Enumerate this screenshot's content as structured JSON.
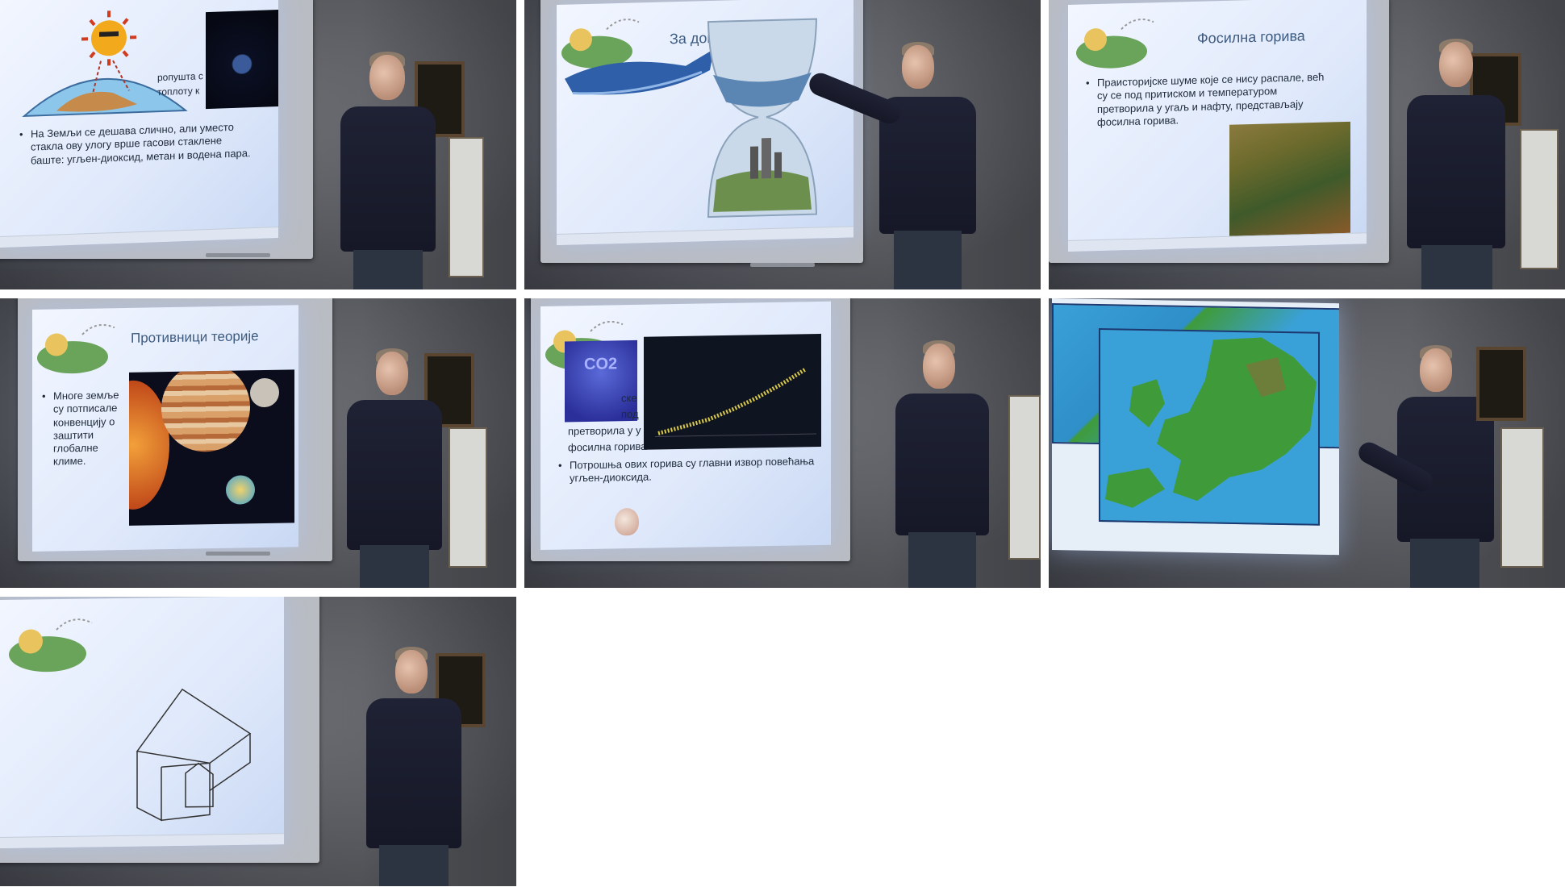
{
  "frames": [
    {
      "id": "greenhouse",
      "text_fragments": [
        "ропушта с",
        "топлоту к"
      ],
      "bullets": [
        "На Земљи се дешава слично, али уместо стакла ову улогу врше гасови стаклене баште: угљен-диоксид, метан и водена пара."
      ]
    },
    {
      "id": "homework",
      "title": "За домаћи..."
    },
    {
      "id": "fossil-fuels",
      "title": "Фосилна горива",
      "bullets": [
        "Праисторијске шуме које се нису распале, већ су се под притиском и температуром претворила у угаљ и нафту, представљају фосилна горива."
      ]
    },
    {
      "id": "opponents",
      "title": "Противници теорије",
      "bullets": [
        "Многе земље су потписале конвенцију о заштити глобалне климе."
      ]
    },
    {
      "id": "co2-graph",
      "fragments": [
        "ске",
        "под",
        "претворила у у",
        "фосилна горива"
      ],
      "co2_label": "CO2",
      "bullets": [
        "Потрошња ових горива су главни извор повећања угљен-диоксида."
      ]
    },
    {
      "id": "europe-map"
    },
    {
      "id": "house-drawing"
    }
  ],
  "colors": {
    "screen": "#eef4ff",
    "title": "#3e5b80",
    "wall": "#5b5e66",
    "sweater": "#1f2234",
    "map_sea": "#3aa0d8",
    "map_land": "#3f9b3a"
  }
}
